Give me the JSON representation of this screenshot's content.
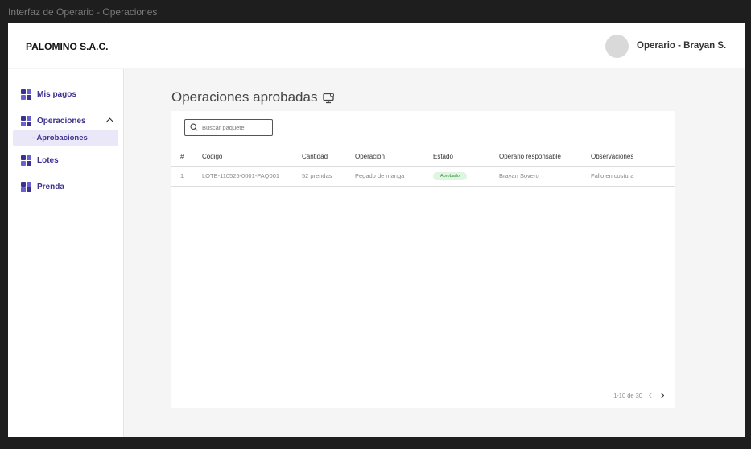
{
  "window": {
    "title": "Interfaz de Operario - Operaciones"
  },
  "header": {
    "brand": "PALOMINO S.A.C.",
    "user": "Operario - Brayan S."
  },
  "sidebar": {
    "items": [
      {
        "label": "Mis pagos"
      },
      {
        "label": "Operaciones",
        "expanded": true
      },
      {
        "label": "Lotes"
      },
      {
        "label": "Prenda"
      }
    ],
    "subitem": "- Aprobaciones"
  },
  "main": {
    "title": "Operaciones aprobadas",
    "search": {
      "placeholder": "Buscar paquete"
    },
    "table": {
      "columns": [
        "#",
        "Código",
        "Cantidad",
        "Operación",
        "Estado",
        "Operario responsable",
        "Observaciones"
      ],
      "rows": [
        {
          "num": "1",
          "codigo": "LOTE-110525-0001-PAQ001",
          "cantidad": "52 prendas",
          "operacion": "Pegado de manga",
          "estado": "Aprobado",
          "operario": "Brayan Sovero",
          "observaciones": "Fallo en costura"
        }
      ]
    },
    "pagination": {
      "text": "1-10 de 30"
    }
  },
  "colors": {
    "accent": "#3c3190",
    "badge_bg": "#dff5e1",
    "badge_text": "#2f8a3a"
  },
  "icons": {
    "nav": "grid-icon",
    "title": "monitor-icon",
    "search": "search-icon"
  }
}
